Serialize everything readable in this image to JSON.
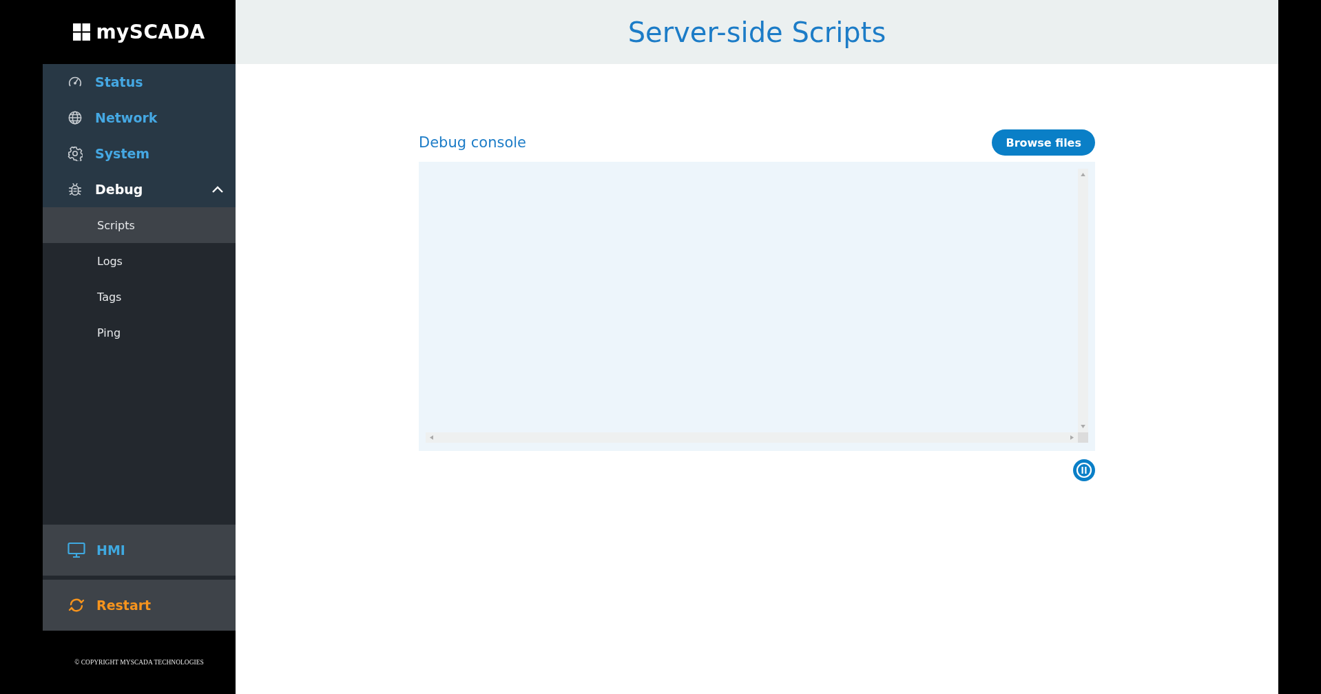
{
  "logo": {
    "text": "mySCADA"
  },
  "sidebar": {
    "items": [
      {
        "label": "Status",
        "selected": false
      },
      {
        "label": "Network",
        "selected": false
      },
      {
        "label": "System",
        "selected": false
      },
      {
        "label": "Debug",
        "selected": true,
        "expanded": true,
        "children": [
          {
            "label": "Scripts",
            "selected": true
          },
          {
            "label": "Logs",
            "selected": false
          },
          {
            "label": "Tags",
            "selected": false
          },
          {
            "label": "Ping",
            "selected": false
          }
        ]
      }
    ],
    "bottom_items": [
      {
        "label": "HMI",
        "color": "#3fa9e0"
      },
      {
        "label": "Restart",
        "color": "#f7941d"
      }
    ],
    "copyright": "© COPYRIGHT MYSCADA TECHNOLOGIES"
  },
  "page": {
    "title": "Server-side Scripts",
    "section_title": "Debug console",
    "browse_button": "Browse files"
  }
}
